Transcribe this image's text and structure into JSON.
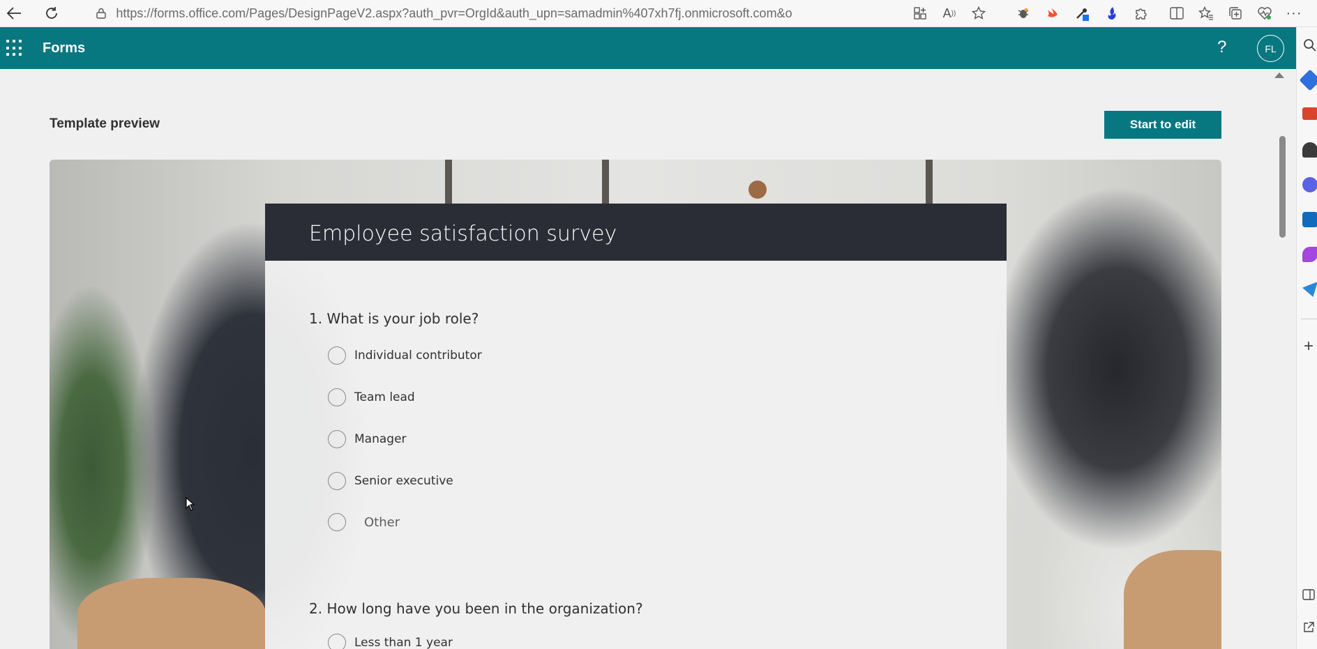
{
  "browser": {
    "url": "https://forms.office.com/Pages/DesignPageV2.aspx?auth_pvr=OrgId&auth_upn=samadmin%407xh7fj.onmicrosoft.com&or...",
    "toolbar_icons": [
      "apps-icon",
      "read-aloud-icon",
      "favorite-star-icon",
      "extension-bug-icon",
      "extension-swift-icon",
      "extension-eyedropper-icon",
      "extension-flame-icon",
      "extensions-puzzle-icon",
      "split-screen-icon",
      "favorites-icon",
      "collections-icon",
      "browser-essentials-icon",
      "more-icon"
    ]
  },
  "header": {
    "app_name": "Forms",
    "help": "?",
    "avatar_initials": "FL"
  },
  "page": {
    "title": "Template preview",
    "start_edit": "Start to edit"
  },
  "survey": {
    "title": "Employee satisfaction survey",
    "questions": [
      {
        "label": "1. What is your job role?",
        "options": [
          "Individual contributor",
          "Team lead",
          "Manager",
          "Senior executive",
          "Other"
        ]
      },
      {
        "label": "2. How long have you been in the organization?",
        "options": [
          "Less than 1 year"
        ]
      }
    ]
  },
  "colors": {
    "accent": "#077780",
    "survey_header": "#2a2d35",
    "page_bg": "#f0f0f0"
  }
}
